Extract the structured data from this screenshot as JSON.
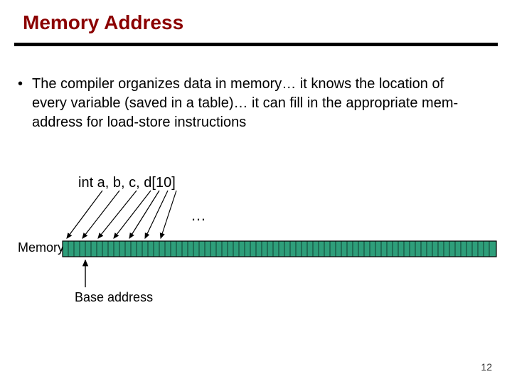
{
  "title": "Memory Address",
  "bullet": "The compiler organizes data in memory… it knows the location of every variable (saved in a table)… it can fill in the appropriate mem-address for load-store instructions",
  "declaration": "int  a, b, c, d[10]",
  "ellipsis": "…",
  "memory_label": "Memory",
  "base_address_label": "Base address",
  "page_number": "12"
}
